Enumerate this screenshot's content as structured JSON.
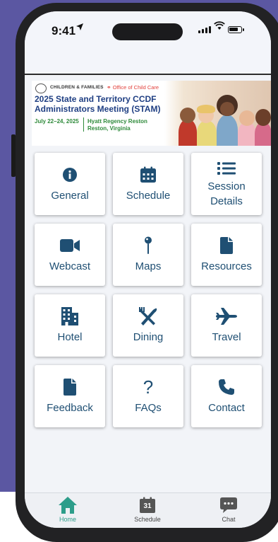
{
  "status_bar": {
    "time": "9:41"
  },
  "banner": {
    "org_acf": "CHILDREN & FAMILIES",
    "org_occ": "Office of Child Care",
    "title": "2025 State and Territory CCDF Administrators Meeting (STAM)",
    "dates": "July 22–24, 2025",
    "venue_line1": "Hyatt Regency Reston",
    "venue_line2": "Reston, Virginia"
  },
  "tiles": [
    {
      "label": "General",
      "icon": "info-icon"
    },
    {
      "label": "Schedule",
      "icon": "calendar-icon"
    },
    {
      "label": "Session Details",
      "icon": "list-icon"
    },
    {
      "label": "Webcast",
      "icon": "video-camera-icon"
    },
    {
      "label": "Maps",
      "icon": "map-pin-icon"
    },
    {
      "label": "Resources",
      "icon": "document-icon"
    },
    {
      "label": "Hotel",
      "icon": "building-icon"
    },
    {
      "label": "Dining",
      "icon": "utensils-icon"
    },
    {
      "label": "Travel",
      "icon": "plane-icon"
    },
    {
      "label": "Feedback",
      "icon": "document-icon"
    },
    {
      "label": "FAQs",
      "icon": "question-icon"
    },
    {
      "label": "Contact",
      "icon": "phone-icon"
    }
  ],
  "tab_bar": {
    "home": "Home",
    "schedule": "Schedule",
    "schedule_day": "31",
    "chat": "Chat"
  },
  "colors": {
    "tile_text": "#1f4f73",
    "active_tab": "#2d9d8a",
    "background": "#5b57a2",
    "banner_title": "#1f3f83",
    "banner_green": "#2e8a3a"
  }
}
